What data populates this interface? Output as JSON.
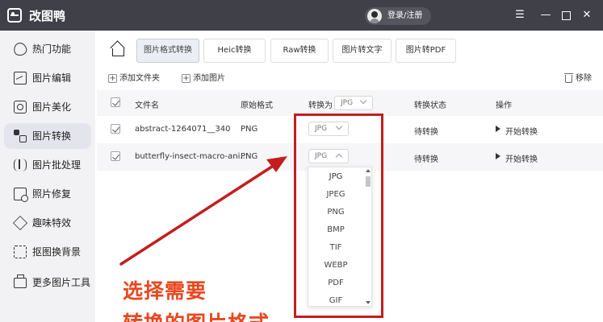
{
  "window": {
    "app_title": "改图鸭",
    "login_label": "登录/注册",
    "controls": [
      "menu",
      "minimize",
      "maximize",
      "close"
    ]
  },
  "sidebar": {
    "items": [
      {
        "label": "热门功能",
        "icon": "fire-icon",
        "active": false
      },
      {
        "label": "图片编辑",
        "icon": "image-edit-icon",
        "active": false
      },
      {
        "label": "图片美化",
        "icon": "beautify-icon",
        "active": false
      },
      {
        "label": "图片转换",
        "icon": "convert-icon",
        "active": true
      },
      {
        "label": "图片批处理",
        "icon": "batch-icon",
        "active": false
      },
      {
        "label": "照片修复",
        "icon": "repair-icon",
        "active": false
      },
      {
        "label": "趣味特效",
        "icon": "effects-icon",
        "active": false
      },
      {
        "label": "抠图换背景",
        "icon": "cutout-icon",
        "active": false
      },
      {
        "label": "更多图片工具",
        "icon": "toolbox-icon",
        "active": false
      }
    ]
  },
  "tabs": {
    "home_icon": "home-icon",
    "items": [
      {
        "label": "图片格式转换",
        "active": true
      },
      {
        "label": "Heic转换",
        "active": false
      },
      {
        "label": "Raw转换",
        "active": false
      },
      {
        "label": "图片转文字",
        "active": false
      },
      {
        "label": "图片转PDF",
        "active": false
      }
    ]
  },
  "actions": {
    "add_folder": "添加文件夹",
    "add_image": "添加图片",
    "remove": "移除"
  },
  "table": {
    "headers": {
      "filename": "文件名",
      "original_format": "原始格式",
      "convert_to": "转换为",
      "convert_to_value": "JPG",
      "status": "转换状态",
      "operation": "操作"
    },
    "rows": [
      {
        "filename": "abstract-1264071__340",
        "format": "PNG",
        "target": "JPG",
        "status": "待转换",
        "action": "开始转换"
      },
      {
        "filename": "butterfly-insect-macro-ani...",
        "format": "PNG",
        "target": "JPG",
        "status": "待转换",
        "action": "开始转换"
      }
    ]
  },
  "dropdown": {
    "options": [
      "JPG",
      "JPEG",
      "PNG",
      "BMP",
      "TIF",
      "WEBP",
      "PDF",
      "GIF"
    ],
    "selected": "JPG"
  },
  "annotation": {
    "line1": "选择需要",
    "line2": "转换的图片格式",
    "color": "#e8471f",
    "box_color": "#c51d1d"
  }
}
